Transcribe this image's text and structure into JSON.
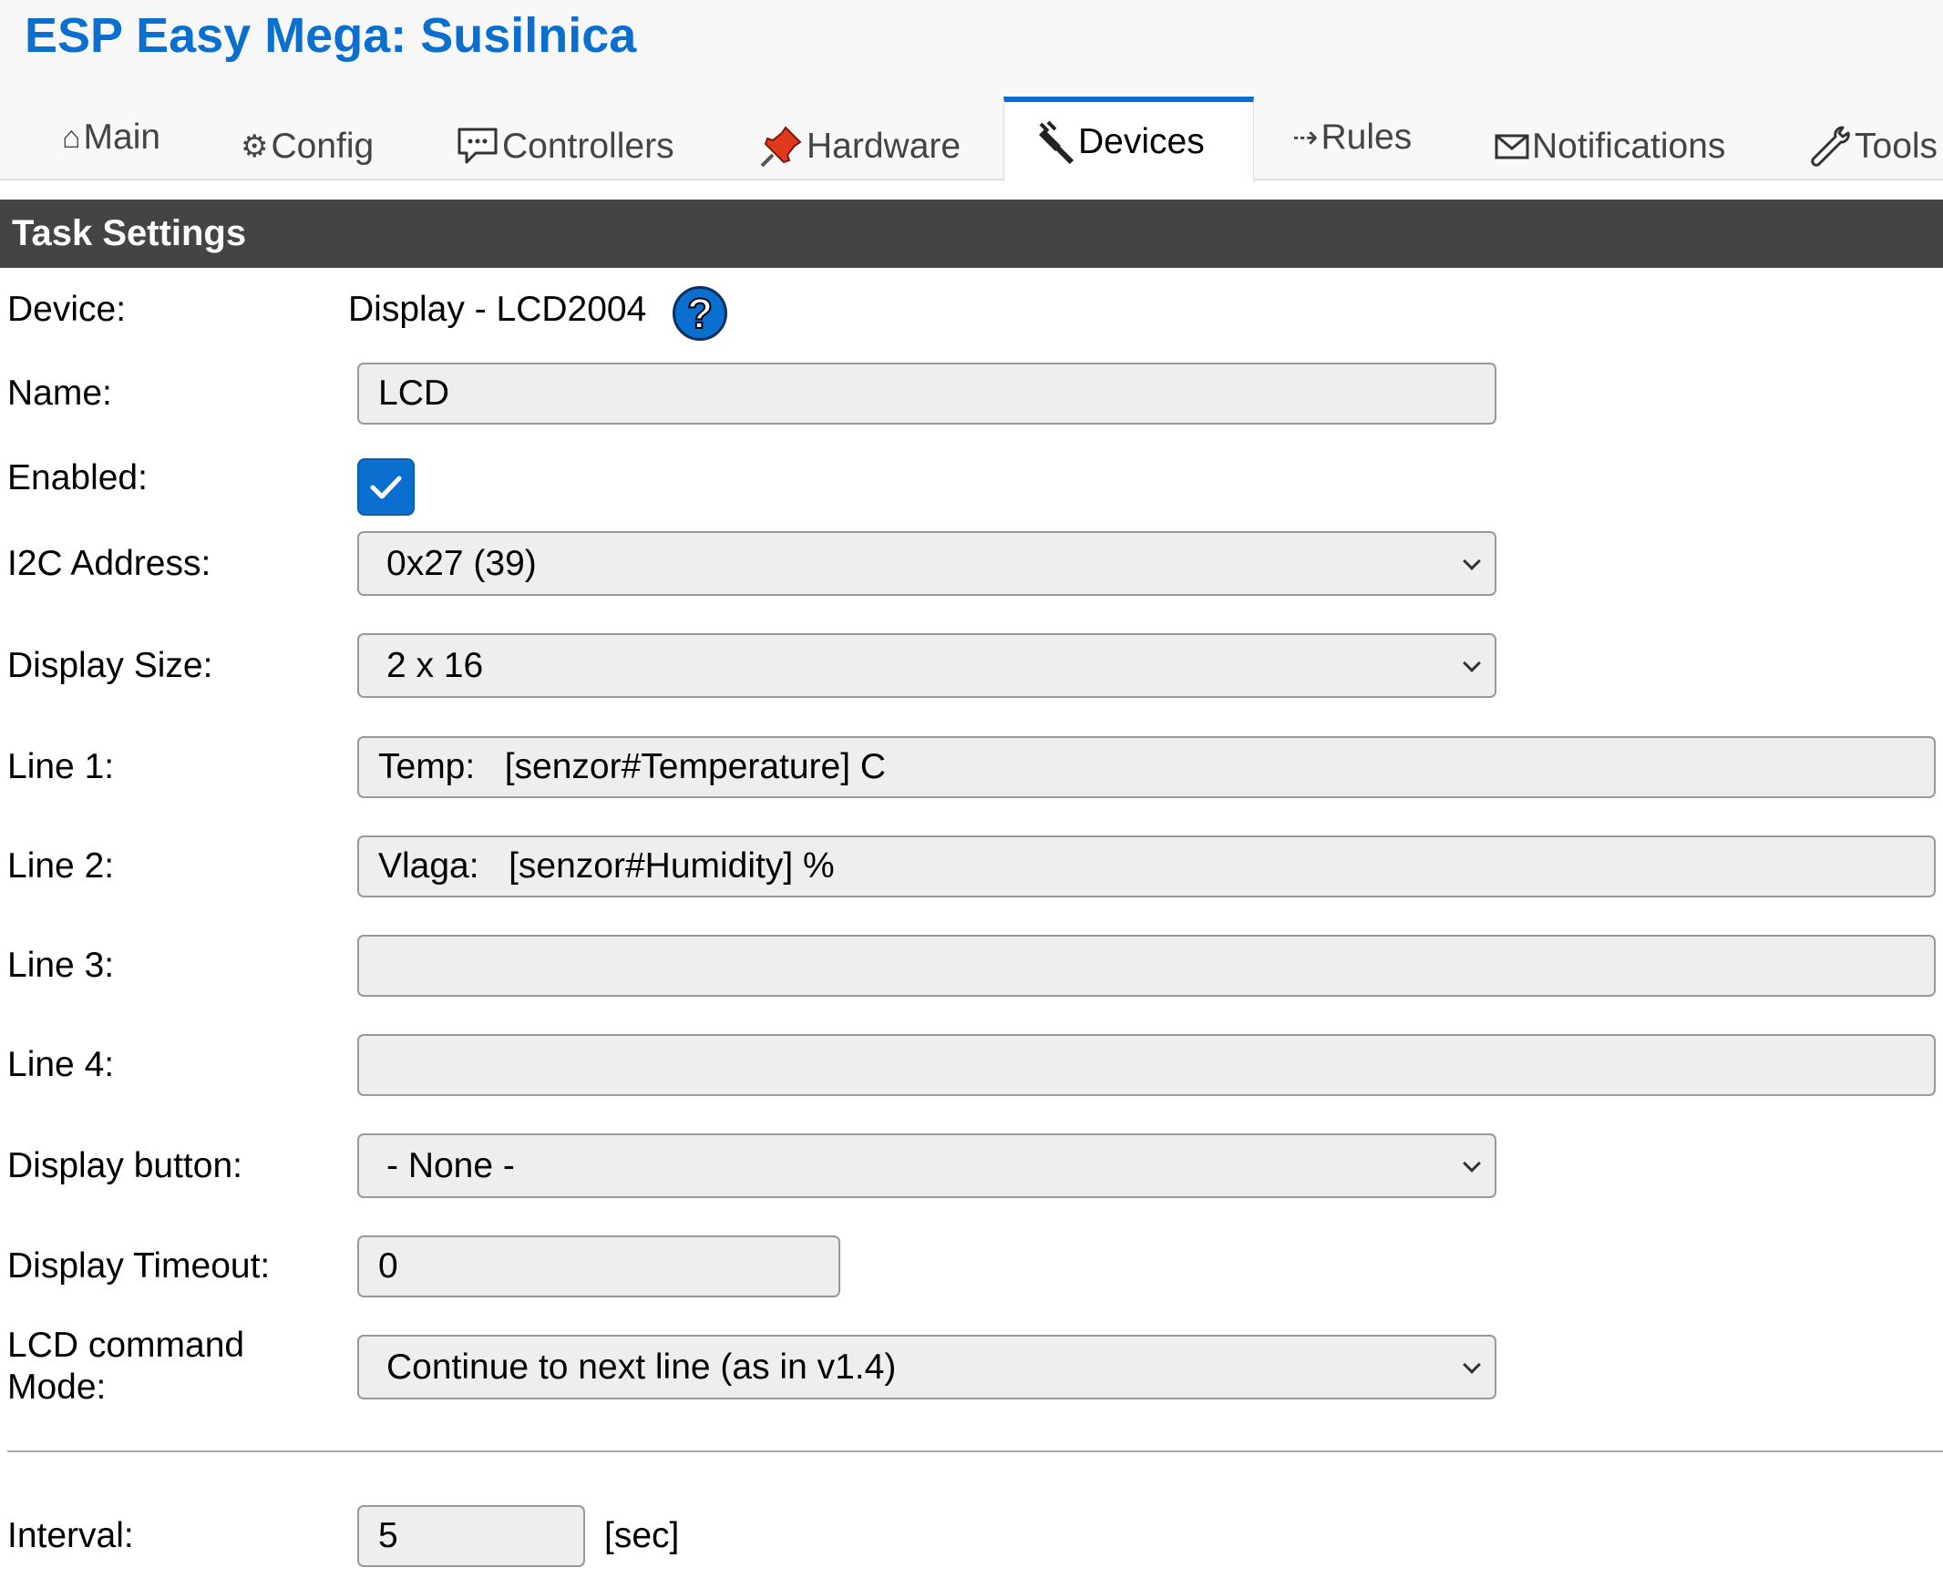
{
  "app": {
    "title": "ESP Easy Mega: Susilnica"
  },
  "tabs": [
    {
      "label": "Main",
      "icon": "home-icon"
    },
    {
      "label": "Config",
      "icon": "gear-icon"
    },
    {
      "label": "Controllers",
      "icon": "chat-icon"
    },
    {
      "label": "Hardware",
      "icon": "pushpin-icon"
    },
    {
      "label": "Devices",
      "icon": "plug-icon",
      "active": true
    },
    {
      "label": "Rules",
      "icon": "arrow-icon"
    },
    {
      "label": "Notifications",
      "icon": "envelope-icon"
    },
    {
      "label": "Tools",
      "icon": "wrench-icon"
    }
  ],
  "section": {
    "title": "Task Settings"
  },
  "form": {
    "device": {
      "label": "Device:",
      "value": "Display - LCD2004",
      "help": "?"
    },
    "name": {
      "label": "Name:",
      "value": "LCD"
    },
    "enabled": {
      "label": "Enabled:",
      "checked": true
    },
    "i2c_address": {
      "label": "I2C Address:",
      "value": "0x27 (39)"
    },
    "display_size": {
      "label": "Display Size:",
      "value": "2 x 16"
    },
    "line1": {
      "label": "Line 1:",
      "value": "Temp:   [senzor#Temperature] C"
    },
    "line2": {
      "label": "Line 2:",
      "value": "Vlaga:   [senzor#Humidity] %"
    },
    "line3": {
      "label": "Line 3:",
      "value": ""
    },
    "line4": {
      "label": "Line 4:",
      "value": ""
    },
    "display_button": {
      "label": "Display button:",
      "value": "- None -"
    },
    "display_timeout": {
      "label": "Display Timeout:",
      "value": "0"
    },
    "lcd_command_mode": {
      "label_line1": "LCD command",
      "label_line2": "Mode:",
      "value": "Continue to next line (as in v1.4)"
    },
    "interval": {
      "label": "Interval:",
      "value": "5",
      "unit": "[sec]"
    }
  },
  "colors": {
    "accent": "#0b6fd0",
    "header_bg": "#444444",
    "field_bg": "#eeeeee"
  }
}
